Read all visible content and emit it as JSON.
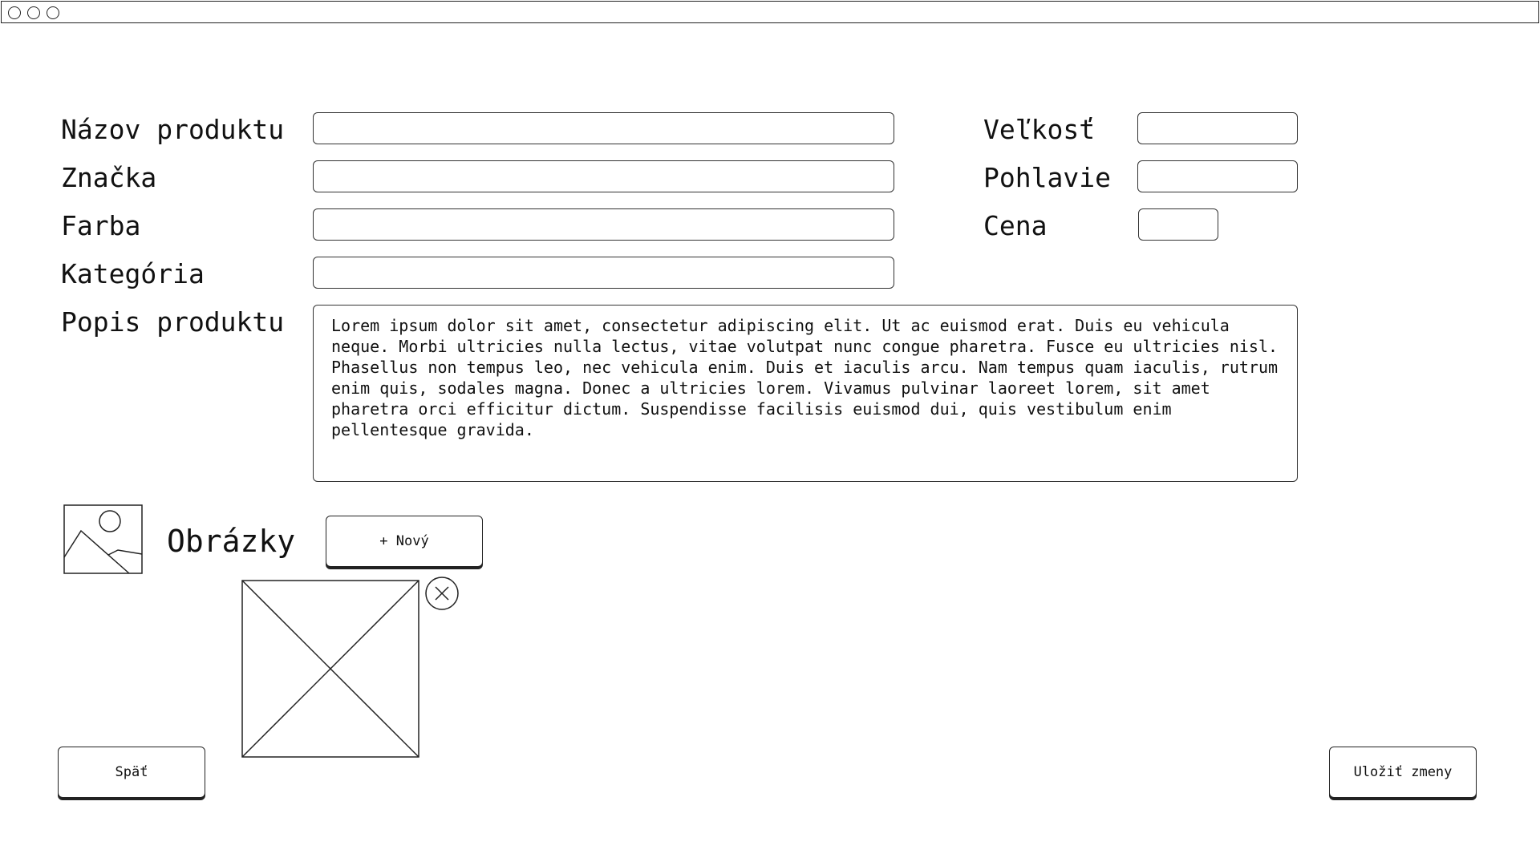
{
  "form": {
    "labels": {
      "product_name": "Názov produktu",
      "brand": "Značka",
      "color": "Farba",
      "category": "Kategória",
      "description": "Popis produktu",
      "size": "Veľkosť",
      "gender": "Pohlavie",
      "price": "Cena"
    },
    "values": {
      "product_name": "",
      "brand": "",
      "color": "",
      "category": "",
      "size": "",
      "gender": "",
      "price": "",
      "description": "Lorem ipsum dolor sit amet, consectetur adipiscing elit. Ut ac euismod erat. Duis eu vehicula neque. Morbi ultricies nulla lectus, vitae volutpat nunc congue pharetra. Fusce eu ultricies nisl. Phasellus non tempus leo, nec vehicula enim. Duis et iaculis arcu. Nam tempus quam iaculis, rutrum enim quis, sodales magna. Donec a ultricies lorem. Vivamus pulvinar laoreet lorem, sit amet pharetra orci efficitur dictum. Suspendisse facilisis euismod dui, quis vestibulum enim pellentesque gravida."
    }
  },
  "images": {
    "heading": "Obrázky",
    "new_button": "+ Nový"
  },
  "footer": {
    "back_button": "Späť",
    "save_button": "Uložiť zmeny"
  },
  "icons": {
    "images_section": "image-icon",
    "thumbnail": "image-placeholder",
    "remove": "close-icon"
  }
}
